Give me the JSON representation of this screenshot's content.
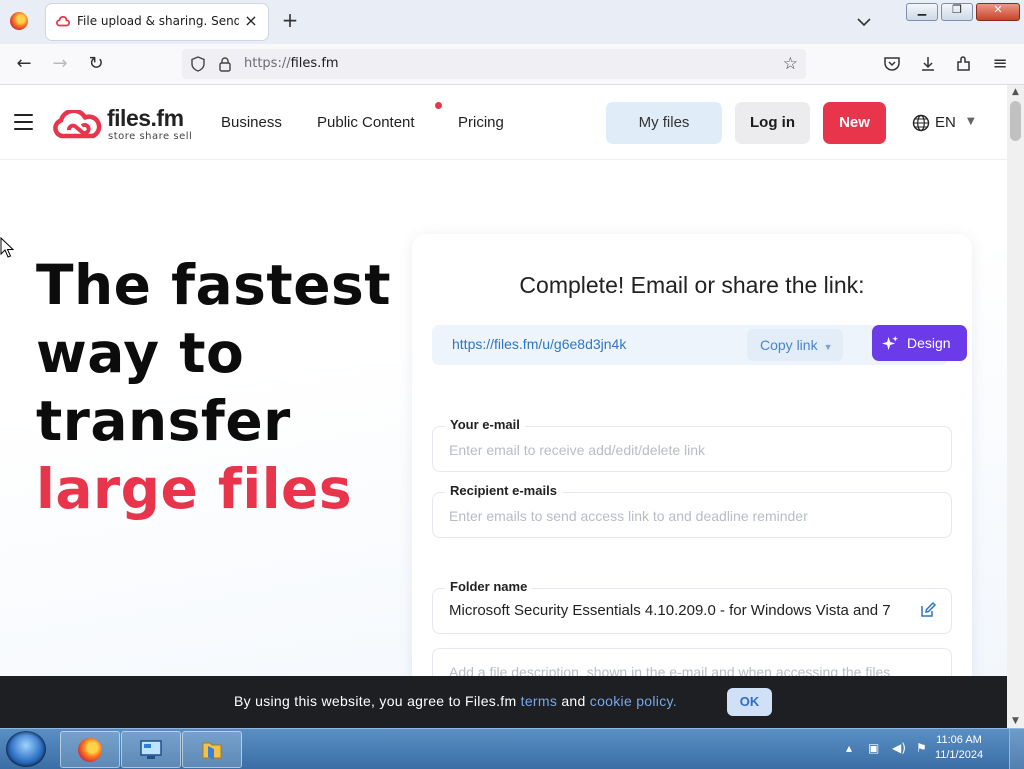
{
  "browser": {
    "tab_title": "File upload & sharing. Send large files",
    "url_protocol": "https://",
    "url_host": "files.fm"
  },
  "header": {
    "logo_name": "files.fm",
    "logo_tagline": "store  share  sell",
    "nav": {
      "business": "Business",
      "public_content": "Public Content",
      "pricing": "Pricing"
    },
    "my_files": "My files",
    "login": "Log in",
    "new": "New",
    "language": "EN"
  },
  "hero": {
    "line1": "The fastest",
    "line2": "way to",
    "line3": "transfer",
    "line4": "large files"
  },
  "card": {
    "title": "Complete! Email or share the link:",
    "share_url": "https://files.fm/u/g6e8d3jn4k",
    "copy_link": "Copy link",
    "design": "Design",
    "your_email_label": "Your e-mail",
    "your_email_placeholder": "Enter email to receive add/edit/delete link",
    "recipient_label": "Recipient e-mails",
    "recipient_placeholder": "Enter emails to send access link to and deadline reminder",
    "folder_label": "Folder name",
    "folder_value": "Microsoft Security Essentials 4.10.209.0 - for Windows Vista and 7",
    "description_placeholder": "Add a file description, shown in the e-mail and when accessing the files"
  },
  "cookie": {
    "text_before": "By using this website, you agree to Files.fm ",
    "terms": "terms",
    "and": " and ",
    "cookie_policy": "cookie policy.",
    "ok": "OK"
  },
  "taskbar": {
    "time": "11:06 AM",
    "date": "11/1/2024"
  },
  "colors": {
    "brand_red": "#e8354b",
    "design_purple": "#6b3bea",
    "link_blue": "#2f77c2"
  }
}
